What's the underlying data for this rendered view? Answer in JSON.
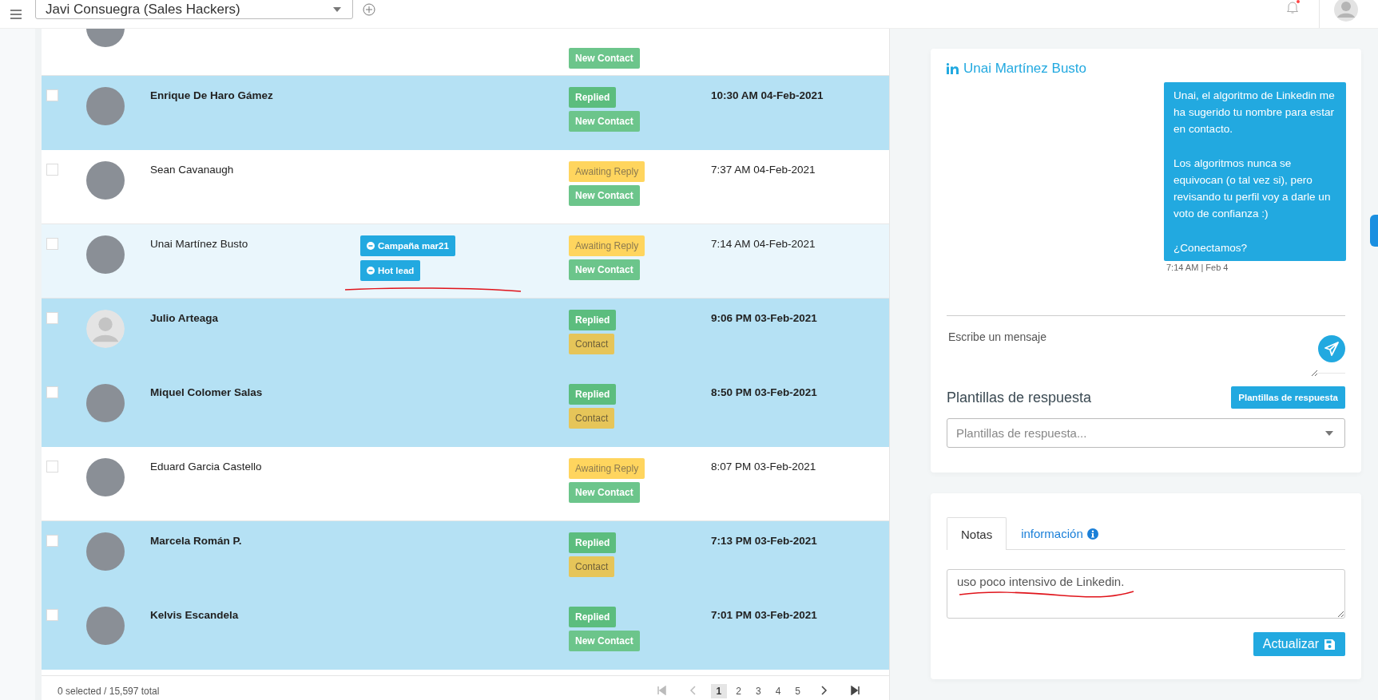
{
  "topbar": {
    "account": "Javi Consuegra (Sales Hackers)",
    "notifications_unread": true
  },
  "contacts": {
    "rows": [
      {
        "cut_off": true,
        "avatar": {
          "kind": "photo"
        },
        "unread": false,
        "selected": false,
        "tags": [],
        "badges": [
          {
            "label": "New Contact",
            "kind": "new-contact"
          }
        ]
      },
      {
        "cut_off": false,
        "avatar": {
          "kind": "photo"
        },
        "name": "Enrique De Haro Gámez",
        "unread": true,
        "selected": false,
        "tags": [],
        "badges": [
          {
            "label": "Replied",
            "kind": "replied"
          },
          {
            "label": "New Contact",
            "kind": "new-contact"
          }
        ],
        "date": "10:30 AM 04-Feb-2021"
      },
      {
        "cut_off": false,
        "avatar": {
          "kind": "photo"
        },
        "name": "Sean Cavanaugh",
        "unread": false,
        "selected": false,
        "tags": [],
        "badges": [
          {
            "label": "Awaiting Reply",
            "kind": "awaiting"
          },
          {
            "label": "New Contact",
            "kind": "new-contact"
          }
        ],
        "date": "7:37 AM 04-Feb-2021"
      },
      {
        "cut_off": false,
        "avatar": {
          "kind": "photo"
        },
        "name": "Unai Martínez Busto",
        "unread": false,
        "selected": true,
        "underlined": true,
        "tags": [
          "Campaña mar21",
          "Hot lead"
        ],
        "badges": [
          {
            "label": "Awaiting Reply",
            "kind": "awaiting"
          },
          {
            "label": "New Contact",
            "kind": "new-contact"
          }
        ],
        "date": "7:14 AM 04-Feb-2021"
      },
      {
        "cut_off": false,
        "avatar": {
          "kind": "placeholder"
        },
        "name": "Julio Arteaga",
        "unread": true,
        "selected": false,
        "tags": [],
        "badges": [
          {
            "label": "Replied",
            "kind": "replied"
          },
          {
            "label": "Contact",
            "kind": "contact"
          }
        ],
        "date": "9:06 PM 03-Feb-2021"
      },
      {
        "cut_off": false,
        "avatar": {
          "kind": "photo"
        },
        "name": "Miquel Colomer Salas",
        "unread": true,
        "selected": false,
        "tags": [],
        "badges": [
          {
            "label": "Replied",
            "kind": "replied"
          },
          {
            "label": "Contact",
            "kind": "contact"
          }
        ],
        "date": "8:50 PM 03-Feb-2021"
      },
      {
        "cut_off": false,
        "avatar": {
          "kind": "photo"
        },
        "name": "Eduard Garcia Castello",
        "unread": false,
        "selected": false,
        "tags": [],
        "badges": [
          {
            "label": "Awaiting Reply",
            "kind": "awaiting"
          },
          {
            "label": "New Contact",
            "kind": "new-contact"
          }
        ],
        "date": "8:07 PM 03-Feb-2021"
      },
      {
        "cut_off": false,
        "avatar": {
          "kind": "photo"
        },
        "name": "Marcela Román P.",
        "unread": true,
        "selected": false,
        "tags": [],
        "badges": [
          {
            "label": "Replied",
            "kind": "replied"
          },
          {
            "label": "Contact",
            "kind": "contact"
          }
        ],
        "date": "7:13 PM 03-Feb-2021"
      },
      {
        "cut_off": false,
        "avatar": {
          "kind": "photo"
        },
        "name": "Kelvis Escandela",
        "unread": true,
        "selected": false,
        "tags": [],
        "badges": [
          {
            "label": "Replied",
            "kind": "replied"
          },
          {
            "label": "New Contact",
            "kind": "new-contact"
          }
        ],
        "date": "7:01 PM 03-Feb-2021"
      }
    ],
    "footer": {
      "selection": "0 selected / 15,597 total",
      "pages": [
        {
          "label": "1",
          "selected": true
        },
        {
          "label": "2",
          "selected": false
        },
        {
          "label": "3",
          "selected": false
        },
        {
          "label": "4",
          "selected": false
        },
        {
          "label": "5",
          "selected": false
        }
      ]
    }
  },
  "chat": {
    "contact": "Unai Martínez Busto",
    "messages": [
      {
        "text": "Unai, el algoritmo de Linkedin me ha sugerido tu nombre para estar en contacto.\n\nLos algoritmos nunca se equivocan (o tal vez si), pero revisando tu perfil voy a darle un voto de confianza :)\n\n¿Conectamos?",
        "time": "7:14 AM | Feb 4"
      }
    ],
    "composer": {
      "placeholder": "Escribe un mensaje"
    }
  },
  "templates": {
    "title": "Plantillas de respuesta",
    "button": "Plantillas de respuesta",
    "select": {
      "placeholder": "Plantillas de respuesta..."
    }
  },
  "notes": {
    "tabs": [
      {
        "label": "Notas",
        "selected": true
      },
      {
        "label": "información",
        "selected": false
      }
    ],
    "value": "uso poco intensivo de Linkedin.",
    "underlined": true,
    "button": "Actualizar"
  }
}
